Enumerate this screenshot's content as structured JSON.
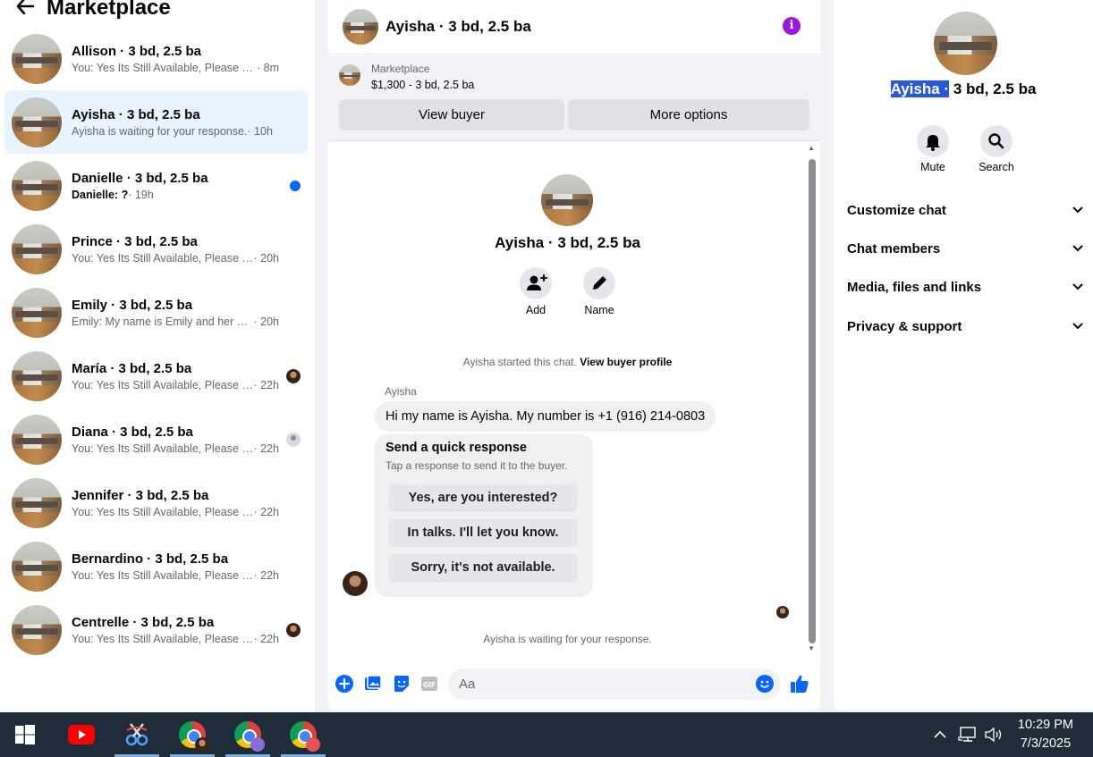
{
  "left": {
    "title": "Marketplace",
    "conversations": [
      {
        "name": "Allison · 3 bd, 2.5 ba",
        "preview": "You: Yes Its Still Available, Please Sen...",
        "time": "· 8m"
      },
      {
        "name": "Ayisha · 3 bd, 2.5 ba",
        "preview": "Ayisha is waiting for your response.",
        "time": "· 10h"
      },
      {
        "name": "Danielle · 3 bd, 2.5 ba",
        "preview": "Danielle: ?",
        "time": "· 19h"
      },
      {
        "name": "Prince · 3 bd, 2.5 ba",
        "preview": "You: Yes Its Still Available, Please Sen...",
        "time": "· 20h"
      },
      {
        "name": "Emily · 3 bd, 2.5 ba",
        "preview": "Emily: My name is Emily and her na...",
        "time": "· 20h"
      },
      {
        "name": "María · 3 bd, 2.5 ba",
        "preview": "You: Yes Its Still Available, Please S...",
        "time": "· 22h"
      },
      {
        "name": "Diana · 3 bd, 2.5 ba",
        "preview": "You: Yes Its Still Available, Please S...",
        "time": "· 22h"
      },
      {
        "name": "Jennifer · 3 bd, 2.5 ba",
        "preview": "You: Yes Its Still Available, Please Sen...",
        "time": "· 22h"
      },
      {
        "name": "Bernardino · 3 bd, 2.5 ba",
        "preview": "You: Yes Its Still Available, Please Sen...",
        "time": "· 22h"
      },
      {
        "name": "Centrelle · 3 bd, 2.5 ba",
        "preview": "You: Yes Its Still Available, Please S...",
        "time": "· 22h"
      }
    ]
  },
  "center": {
    "header_title": "Ayisha · 3 bd, 2.5 ba",
    "marketplace_label": "Marketplace",
    "listing": "$1,300 - 3 bd, 2.5 ba",
    "view_buyer": "View buyer",
    "more_options": "More options",
    "chat_name": "Ayisha · 3 bd, 2.5 ba",
    "add_label": "Add",
    "name_label": "Name",
    "started_text": "Ayisha started this chat.",
    "view_profile": "View buyer profile",
    "sender": "Ayisha",
    "message": "Hi my name is Ayisha. My number is +1 (916) 214-0803",
    "quick_title": "Send a quick response",
    "quick_sub": "Tap a response to send it to the buyer.",
    "quick_responses": [
      "Yes, are you interested?",
      "In talks. I'll let you know.",
      "Sorry, it's not available."
    ],
    "waiting": "Ayisha is waiting for your response.",
    "input_placeholder": "Aa"
  },
  "right": {
    "title_selected": "Ayisha ·",
    "title_rest": " 3 bd, 2.5 ba",
    "mute": "Mute",
    "search": "Search",
    "sections": [
      "Customize chat",
      "Chat members",
      "Media, files and links",
      "Privacy & support"
    ]
  },
  "taskbar": {
    "time": "10:29 PM",
    "date": "7/3/2025"
  },
  "colors": {
    "accent": "#0866ff",
    "info": "#9a17e0",
    "active_row": "#e7f3ff",
    "taskbar": "#1f2d3a"
  }
}
